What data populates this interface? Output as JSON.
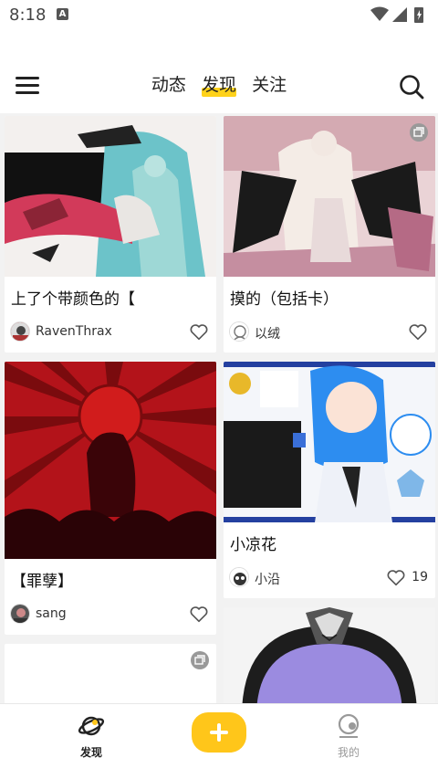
{
  "status": {
    "time": "8:18",
    "notif_letter": "A"
  },
  "header": {
    "tabs": [
      {
        "label": "动态",
        "active": false
      },
      {
        "label": "发现",
        "active": true
      },
      {
        "label": "关注",
        "active": false
      }
    ]
  },
  "feed": {
    "left": [
      {
        "title": "上了个带颜色的【",
        "user": "RavenThrax",
        "likes": ""
      },
      {
        "title": "【罪孽】",
        "user": "sang",
        "likes": ""
      },
      {
        "title": "",
        "user": "",
        "likes": ""
      }
    ],
    "right": [
      {
        "title": "摸的（包括卡）",
        "user": "以绒",
        "likes": ""
      },
      {
        "title": "小凉花",
        "user": "小沿",
        "likes": "19"
      },
      {
        "title": "",
        "user": "",
        "likes": ""
      }
    ]
  },
  "bottom_nav": {
    "discover_label": "发现",
    "me_label": "我的"
  },
  "colors": {
    "accent": "#ffc61a",
    "tab_highlight": "#ffd21a"
  }
}
